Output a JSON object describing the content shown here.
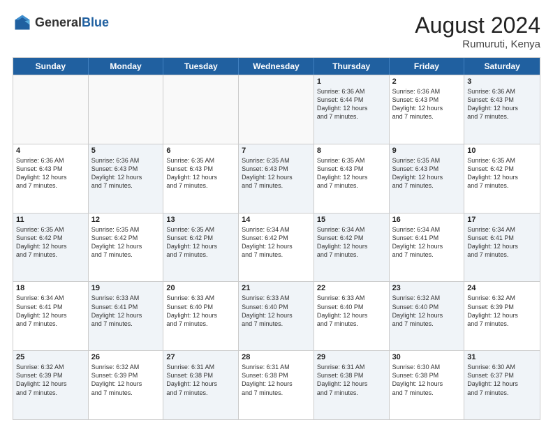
{
  "logo": {
    "general": "General",
    "blue": "Blue"
  },
  "title": "August 2024",
  "subtitle": "Rumuruti, Kenya",
  "days_of_week": [
    "Sunday",
    "Monday",
    "Tuesday",
    "Wednesday",
    "Thursday",
    "Friday",
    "Saturday"
  ],
  "weeks": [
    [
      {
        "day": "",
        "text": "",
        "empty": true
      },
      {
        "day": "",
        "text": "",
        "empty": true
      },
      {
        "day": "",
        "text": "",
        "empty": true
      },
      {
        "day": "",
        "text": "",
        "empty": true
      },
      {
        "day": "1",
        "text": "Sunrise: 6:36 AM\nSunset: 6:44 PM\nDaylight: 12 hours\nand 7 minutes.",
        "empty": false
      },
      {
        "day": "2",
        "text": "Sunrise: 6:36 AM\nSunset: 6:43 PM\nDaylight: 12 hours\nand 7 minutes.",
        "empty": false
      },
      {
        "day": "3",
        "text": "Sunrise: 6:36 AM\nSunset: 6:43 PM\nDaylight: 12 hours\nand 7 minutes.",
        "empty": false
      }
    ],
    [
      {
        "day": "4",
        "text": "Sunrise: 6:36 AM\nSunset: 6:43 PM\nDaylight: 12 hours\nand 7 minutes.",
        "empty": false
      },
      {
        "day": "5",
        "text": "Sunrise: 6:36 AM\nSunset: 6:43 PM\nDaylight: 12 hours\nand 7 minutes.",
        "empty": false
      },
      {
        "day": "6",
        "text": "Sunrise: 6:35 AM\nSunset: 6:43 PM\nDaylight: 12 hours\nand 7 minutes.",
        "empty": false
      },
      {
        "day": "7",
        "text": "Sunrise: 6:35 AM\nSunset: 6:43 PM\nDaylight: 12 hours\nand 7 minutes.",
        "empty": false
      },
      {
        "day": "8",
        "text": "Sunrise: 6:35 AM\nSunset: 6:43 PM\nDaylight: 12 hours\nand 7 minutes.",
        "empty": false
      },
      {
        "day": "9",
        "text": "Sunrise: 6:35 AM\nSunset: 6:43 PM\nDaylight: 12 hours\nand 7 minutes.",
        "empty": false
      },
      {
        "day": "10",
        "text": "Sunrise: 6:35 AM\nSunset: 6:42 PM\nDaylight: 12 hours\nand 7 minutes.",
        "empty": false
      }
    ],
    [
      {
        "day": "11",
        "text": "Sunrise: 6:35 AM\nSunset: 6:42 PM\nDaylight: 12 hours\nand 7 minutes.",
        "empty": false
      },
      {
        "day": "12",
        "text": "Sunrise: 6:35 AM\nSunset: 6:42 PM\nDaylight: 12 hours\nand 7 minutes.",
        "empty": false
      },
      {
        "day": "13",
        "text": "Sunrise: 6:35 AM\nSunset: 6:42 PM\nDaylight: 12 hours\nand 7 minutes.",
        "empty": false
      },
      {
        "day": "14",
        "text": "Sunrise: 6:34 AM\nSunset: 6:42 PM\nDaylight: 12 hours\nand 7 minutes.",
        "empty": false
      },
      {
        "day": "15",
        "text": "Sunrise: 6:34 AM\nSunset: 6:42 PM\nDaylight: 12 hours\nand 7 minutes.",
        "empty": false
      },
      {
        "day": "16",
        "text": "Sunrise: 6:34 AM\nSunset: 6:41 PM\nDaylight: 12 hours\nand 7 minutes.",
        "empty": false
      },
      {
        "day": "17",
        "text": "Sunrise: 6:34 AM\nSunset: 6:41 PM\nDaylight: 12 hours\nand 7 minutes.",
        "empty": false
      }
    ],
    [
      {
        "day": "18",
        "text": "Sunrise: 6:34 AM\nSunset: 6:41 PM\nDaylight: 12 hours\nand 7 minutes.",
        "empty": false
      },
      {
        "day": "19",
        "text": "Sunrise: 6:33 AM\nSunset: 6:41 PM\nDaylight: 12 hours\nand 7 minutes.",
        "empty": false
      },
      {
        "day": "20",
        "text": "Sunrise: 6:33 AM\nSunset: 6:40 PM\nDaylight: 12 hours\nand 7 minutes.",
        "empty": false
      },
      {
        "day": "21",
        "text": "Sunrise: 6:33 AM\nSunset: 6:40 PM\nDaylight: 12 hours\nand 7 minutes.",
        "empty": false
      },
      {
        "day": "22",
        "text": "Sunrise: 6:33 AM\nSunset: 6:40 PM\nDaylight: 12 hours\nand 7 minutes.",
        "empty": false
      },
      {
        "day": "23",
        "text": "Sunrise: 6:32 AM\nSunset: 6:40 PM\nDaylight: 12 hours\nand 7 minutes.",
        "empty": false
      },
      {
        "day": "24",
        "text": "Sunrise: 6:32 AM\nSunset: 6:39 PM\nDaylight: 12 hours\nand 7 minutes.",
        "empty": false
      }
    ],
    [
      {
        "day": "25",
        "text": "Sunrise: 6:32 AM\nSunset: 6:39 PM\nDaylight: 12 hours\nand 7 minutes.",
        "empty": false
      },
      {
        "day": "26",
        "text": "Sunrise: 6:32 AM\nSunset: 6:39 PM\nDaylight: 12 hours\nand 7 minutes.",
        "empty": false
      },
      {
        "day": "27",
        "text": "Sunrise: 6:31 AM\nSunset: 6:38 PM\nDaylight: 12 hours\nand 7 minutes.",
        "empty": false
      },
      {
        "day": "28",
        "text": "Sunrise: 6:31 AM\nSunset: 6:38 PM\nDaylight: 12 hours\nand 7 minutes.",
        "empty": false
      },
      {
        "day": "29",
        "text": "Sunrise: 6:31 AM\nSunset: 6:38 PM\nDaylight: 12 hours\nand 7 minutes.",
        "empty": false
      },
      {
        "day": "30",
        "text": "Sunrise: 6:30 AM\nSunset: 6:38 PM\nDaylight: 12 hours\nand 7 minutes.",
        "empty": false
      },
      {
        "day": "31",
        "text": "Sunrise: 6:30 AM\nSunset: 6:37 PM\nDaylight: 12 hours\nand 7 minutes.",
        "empty": false
      }
    ]
  ]
}
